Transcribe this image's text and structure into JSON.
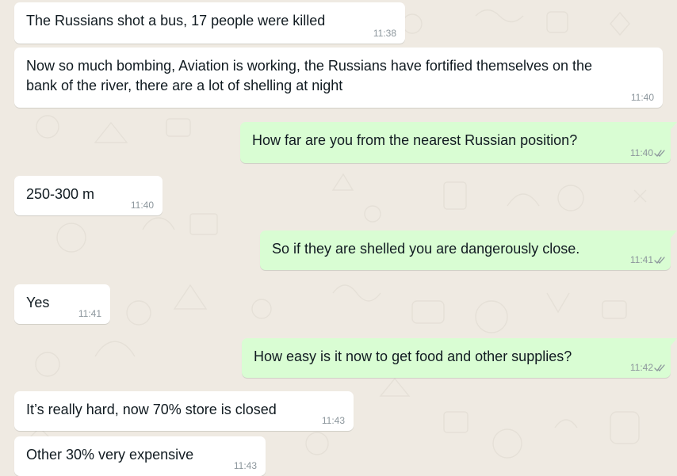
{
  "conversation": {
    "messages": [
      {
        "direction": "incoming",
        "text": "The Russians shot a bus, 17 people were killed",
        "time": "11:38"
      },
      {
        "direction": "incoming",
        "text": "Now so much bombing, Aviation is working, the Russians have fortified themselves on the\nbank of the river, there are a lot of shelling at night",
        "time": "11:40"
      },
      {
        "direction": "outgoing",
        "text": "How far are you from the nearest Russian position?",
        "time": "11:40",
        "status": "delivered"
      },
      {
        "direction": "incoming",
        "text": "250-300 m",
        "time": "11:40"
      },
      {
        "direction": "outgoing",
        "text": "So if they are shelled you are dangerously close.",
        "time": "11:41",
        "status": "delivered"
      },
      {
        "direction": "incoming",
        "text": "Yes",
        "time": "11:41"
      },
      {
        "direction": "outgoing",
        "text": "How easy is it now to get food and other supplies?",
        "time": "11:42",
        "status": "delivered"
      },
      {
        "direction": "incoming",
        "text": "It’s really hard, now 70% store is closed",
        "time": "11:43"
      },
      {
        "direction": "incoming",
        "text": "Other 30% very expensive",
        "time": "11:43"
      }
    ]
  },
  "colors": {
    "background": "#efeae2",
    "incoming_bubble": "#ffffff",
    "outgoing_bubble": "#d9fdd3",
    "text": "#111b21",
    "meta": "#8c969c"
  },
  "icons": {
    "read_status": "double-check-icon"
  }
}
